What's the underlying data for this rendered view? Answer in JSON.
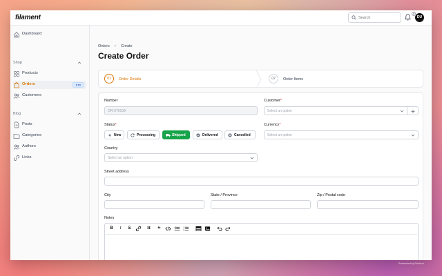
{
  "app": {
    "logo": "filament"
  },
  "topbar": {
    "search_placeholder": "Search",
    "notification_count": "0",
    "avatar_initials": "DU"
  },
  "sidebar": {
    "dashboard": "Dashboard",
    "groups": [
      {
        "label": "Shop",
        "items": [
          {
            "label": "Products"
          },
          {
            "label": "Orders",
            "badge": "172"
          },
          {
            "label": "Customers"
          }
        ]
      },
      {
        "label": "Blog",
        "items": [
          {
            "label": "Posts"
          },
          {
            "label": "Categories"
          },
          {
            "label": "Authors"
          },
          {
            "label": "Links"
          }
        ]
      }
    ]
  },
  "breadcrumb": [
    "Orders",
    ">",
    "Create"
  ],
  "page_title": "Create Order",
  "wizard": {
    "steps": [
      {
        "number": "01",
        "label": "Order Details"
      },
      {
        "number": "02",
        "label": "Order Items"
      }
    ]
  },
  "form": {
    "number": {
      "label": "Number",
      "value": "OR-370109"
    },
    "customer": {
      "label": "Customer",
      "required_mark": "*",
      "placeholder": "Select an option"
    },
    "status": {
      "label": "Status",
      "required_mark": "*",
      "options": [
        "New",
        "Processing",
        "Shipped",
        "Delivered",
        "Cancelled"
      ],
      "selected": "Shipped"
    },
    "currency": {
      "label": "Currency",
      "required_mark": "*",
      "placeholder": "Select an option"
    },
    "country": {
      "label": "Country",
      "placeholder": "Select an option"
    },
    "street": {
      "label": "Street address"
    },
    "city": {
      "label": "City"
    },
    "state": {
      "label": "State / Province"
    },
    "zip": {
      "label": "Zip / Postal code"
    },
    "notes": {
      "label": "Notes"
    }
  },
  "editor_tools": [
    "B",
    "I",
    "S",
    "link",
    "H",
    "quote",
    "code",
    "bullet-list",
    "numbered-list",
    "table",
    "image",
    "undo",
    "redo"
  ],
  "watermark": "Screenshot by Shots.so",
  "colors": {
    "accent": "#d97706",
    "success": "#16a34a",
    "badge_bg": "#dbeafe"
  }
}
